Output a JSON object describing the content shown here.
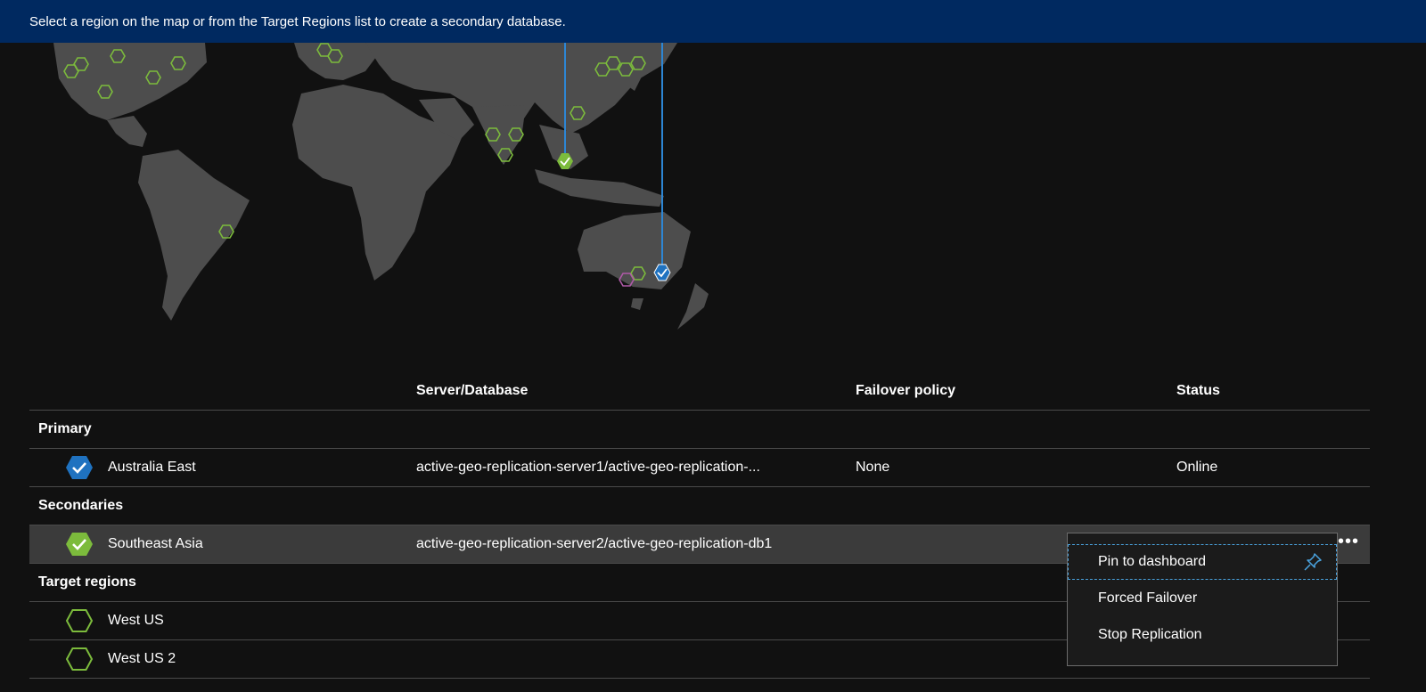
{
  "banner": {
    "text": "Select a region on the map or from the Target Regions list to create a secondary database."
  },
  "map": {
    "land_color": "#4d4d4d",
    "available_region_color": "#7cbb3c",
    "primary_color": "#1f72c0",
    "link_color": "#2d86d4"
  },
  "table": {
    "headers": {
      "region": "",
      "server": "Server/Database",
      "policy": "Failover policy",
      "status": "Status"
    },
    "groups": {
      "primary": "Primary",
      "secondaries": "Secondaries",
      "targets": "Target regions"
    },
    "primary_row": {
      "region": "Australia East",
      "server": "active-geo-replication-server1/active-geo-replication-...",
      "policy": "None",
      "status": "Online"
    },
    "secondary_row": {
      "region": "Southeast Asia",
      "server": "active-geo-replication-server2/active-geo-replication-db1",
      "more": "•••"
    },
    "target_rows": [
      {
        "region": "West US"
      },
      {
        "region": "West US 2"
      }
    ]
  },
  "context_menu": {
    "items": [
      "Pin to dashboard",
      "Forced Failover",
      "Stop Replication"
    ],
    "pin_icon": "pin-icon"
  }
}
